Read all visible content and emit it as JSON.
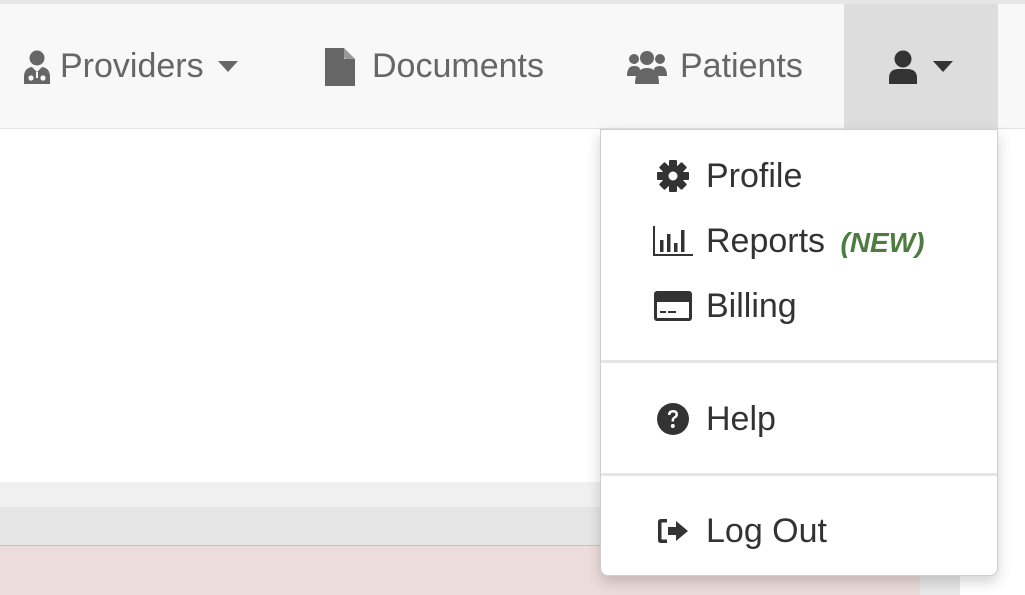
{
  "nav": {
    "providers": {
      "label": "Providers",
      "icon": "user-md-icon"
    },
    "documents": {
      "label": "Documents",
      "icon": "file-icon"
    },
    "patients": {
      "label": "Patients",
      "icon": "users-icon"
    },
    "user_menu": {
      "icon": "user-icon",
      "expanded": true
    }
  },
  "dropdown": {
    "items": [
      {
        "label": "Profile",
        "icon": "gear-icon"
      },
      {
        "label": "Reports",
        "badge": "(NEW)",
        "icon": "bar-chart-icon"
      },
      {
        "label": "Billing",
        "icon": "credit-card-icon"
      },
      {
        "label": "Help",
        "icon": "question-circle-icon"
      },
      {
        "label": "Log Out",
        "icon": "sign-out-icon"
      }
    ]
  },
  "colors": {
    "navbar_bg": "#f8f8f8",
    "nav_text": "#666666",
    "active_tab_bg": "#dddddd",
    "menu_text": "#333333",
    "badge_new": "#4e7b40",
    "alert_bg": "#eddcdc"
  }
}
